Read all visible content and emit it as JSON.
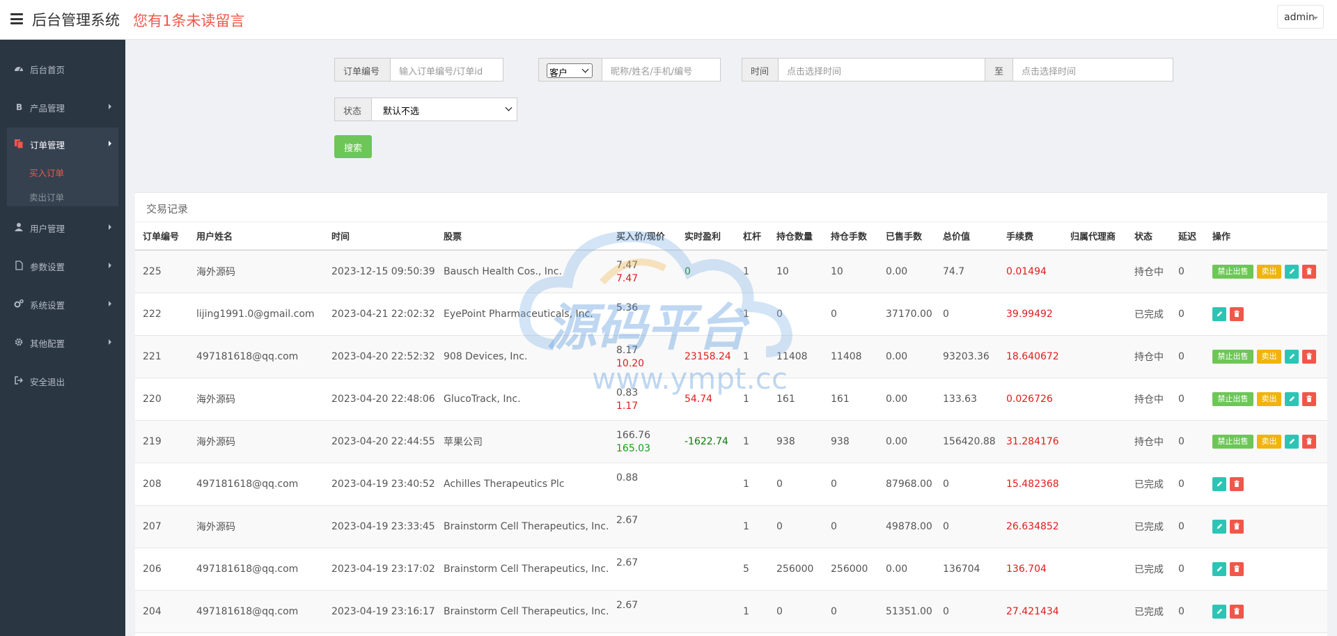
{
  "header": {
    "title": "后台管理系统",
    "unread": "您有1条未读留言",
    "user": "admin"
  },
  "sidebar": {
    "items": [
      {
        "label": "后台首页",
        "icon": "dashboard-icon"
      },
      {
        "label": "产品管理",
        "icon": "bitcoin-icon"
      },
      {
        "label": "订单管理",
        "icon": "files-icon"
      },
      {
        "label": "用户管理",
        "icon": "user-icon"
      },
      {
        "label": "参数设置",
        "icon": "file-icon"
      },
      {
        "label": "系统设置",
        "icon": "gears-icon"
      },
      {
        "label": "其他配置",
        "icon": "gear-icon"
      },
      {
        "label": "安全退出",
        "icon": "sign-out-icon"
      }
    ],
    "sub_items": [
      {
        "label": "买入订单",
        "active": true
      },
      {
        "label": "卖出订单",
        "active": false
      }
    ]
  },
  "filters": {
    "order_no_label": "订单编号",
    "order_no_placeholder": "输入订单编号/订单id",
    "customer_select": "客户",
    "customer_placeholder": "昵称/姓名/手机/编号",
    "time_label": "时间",
    "time_start_placeholder": "点击选择时间",
    "to_label": "至",
    "time_end_placeholder": "点击选择时间",
    "status_label": "状态",
    "status_select": "默认不选",
    "search_button": "搜索"
  },
  "panel": {
    "title": "交易记录",
    "columns": [
      "订单编号",
      "用户姓名",
      "时间",
      "股票",
      "买入价/现价",
      "实时盈利",
      "杠杆",
      "持仓数量",
      "持仓手数",
      "已售手数",
      "总价值",
      "手续费",
      "归属代理商",
      "状态",
      "延迟",
      "操作"
    ],
    "ops_labels": {
      "ban": "禁止出售",
      "sell": "卖出"
    },
    "rows": [
      {
        "id": "225",
        "user": "海外源码",
        "time": "2023-12-15 09:50:39",
        "stock": "Bausch Health Cos., Inc.",
        "buy": "7.47",
        "cur": "7.47",
        "profit": "0",
        "profit_color": "dkgreen",
        "leverage": "1",
        "qty": "10",
        "lots": "10",
        "sold": "0.00",
        "total": "74.7",
        "fee": "0.01494",
        "agent": "",
        "status": "持仓中",
        "delay": "0",
        "holding": true
      },
      {
        "id": "222",
        "user": "lijing1991.0@gmail.com",
        "time": "2023-04-21 22:02:32",
        "stock": "EyePoint Pharmaceuticals, Inc.",
        "buy": "5.36",
        "cur": "",
        "profit": "",
        "profit_color": "",
        "leverage": "1",
        "qty": "0",
        "lots": "0",
        "sold": "37170.00",
        "total": "0",
        "fee": "39.99492",
        "agent": "",
        "status": "已完成",
        "delay": "0",
        "holding": false
      },
      {
        "id": "221",
        "user": "497181618@qq.com",
        "time": "2023-04-20 22:52:32",
        "stock": "908 Devices, Inc.",
        "buy": "8.17",
        "cur": "10.20",
        "profit": "23158.24",
        "profit_color": "red",
        "leverage": "1",
        "qty": "11408",
        "lots": "11408",
        "sold": "0.00",
        "total": "93203.36",
        "fee": "18.640672",
        "agent": "",
        "status": "持仓中",
        "delay": "0",
        "holding": true
      },
      {
        "id": "220",
        "user": "海外源码",
        "time": "2023-04-20 22:48:06",
        "stock": "GlucoTrack, Inc.",
        "buy": "0.83",
        "cur": "1.17",
        "profit": "54.74",
        "profit_color": "red",
        "leverage": "1",
        "qty": "161",
        "lots": "161",
        "sold": "0.00",
        "total": "133.63",
        "fee": "0.026726",
        "agent": "",
        "status": "持仓中",
        "delay": "0",
        "holding": true
      },
      {
        "id": "219",
        "user": "海外源码",
        "time": "2023-04-20 22:44:55",
        "stock": "苹果公司",
        "buy": "166.76",
        "cur": "165.03",
        "cur_color": "green",
        "profit": "-1622.74",
        "profit_color": "dkgreen",
        "leverage": "1",
        "qty": "938",
        "lots": "938",
        "sold": "0.00",
        "total": "156420.88",
        "fee": "31.284176",
        "agent": "",
        "status": "持仓中",
        "delay": "0",
        "holding": true
      },
      {
        "id": "208",
        "user": "497181618@qq.com",
        "time": "2023-04-19 23:40:52",
        "stock": "Achilles Therapeutics Plc",
        "buy": "0.88",
        "cur": "",
        "profit": "",
        "profit_color": "",
        "leverage": "1",
        "qty": "0",
        "lots": "0",
        "sold": "87968.00",
        "total": "0",
        "fee": "15.482368",
        "agent": "",
        "status": "已完成",
        "delay": "0",
        "holding": false
      },
      {
        "id": "207",
        "user": "海外源码",
        "time": "2023-04-19 23:33:45",
        "stock": "Brainstorm Cell Therapeutics, Inc.",
        "buy": "2.67",
        "cur": "",
        "profit": "",
        "profit_color": "",
        "leverage": "1",
        "qty": "0",
        "lots": "0",
        "sold": "49878.00",
        "total": "0",
        "fee": "26.634852",
        "agent": "",
        "status": "已完成",
        "delay": "0",
        "holding": false
      },
      {
        "id": "206",
        "user": "497181618@qq.com",
        "time": "2023-04-19 23:17:02",
        "stock": "Brainstorm Cell Therapeutics, Inc.",
        "buy": "2.67",
        "cur": "",
        "profit": "",
        "profit_color": "",
        "leverage": "5",
        "qty": "256000",
        "lots": "256000",
        "sold": "0.00",
        "total": "136704",
        "fee": "136.704",
        "agent": "",
        "status": "已完成",
        "delay": "0",
        "holding": false
      },
      {
        "id": "204",
        "user": "497181618@qq.com",
        "time": "2023-04-19 23:16:17",
        "stock": "Brainstorm Cell Therapeutics, Inc.",
        "buy": "2.67",
        "cur": "",
        "profit": "",
        "profit_color": "",
        "leverage": "1",
        "qty": "0",
        "lots": "0",
        "sold": "51351.00",
        "total": "0",
        "fee": "27.421434",
        "agent": "",
        "status": "已完成",
        "delay": "0",
        "holding": false
      }
    ]
  },
  "watermark": {
    "text1": "源码平台",
    "text2": "www.ympt.cc"
  },
  "colors": {
    "sidebar_bg": "#2b3643",
    "accent_red": "#f0574a",
    "green_btn": "#6dc657",
    "yellow_btn": "#f0b40e",
    "teal_btn": "#2cc5b5"
  }
}
